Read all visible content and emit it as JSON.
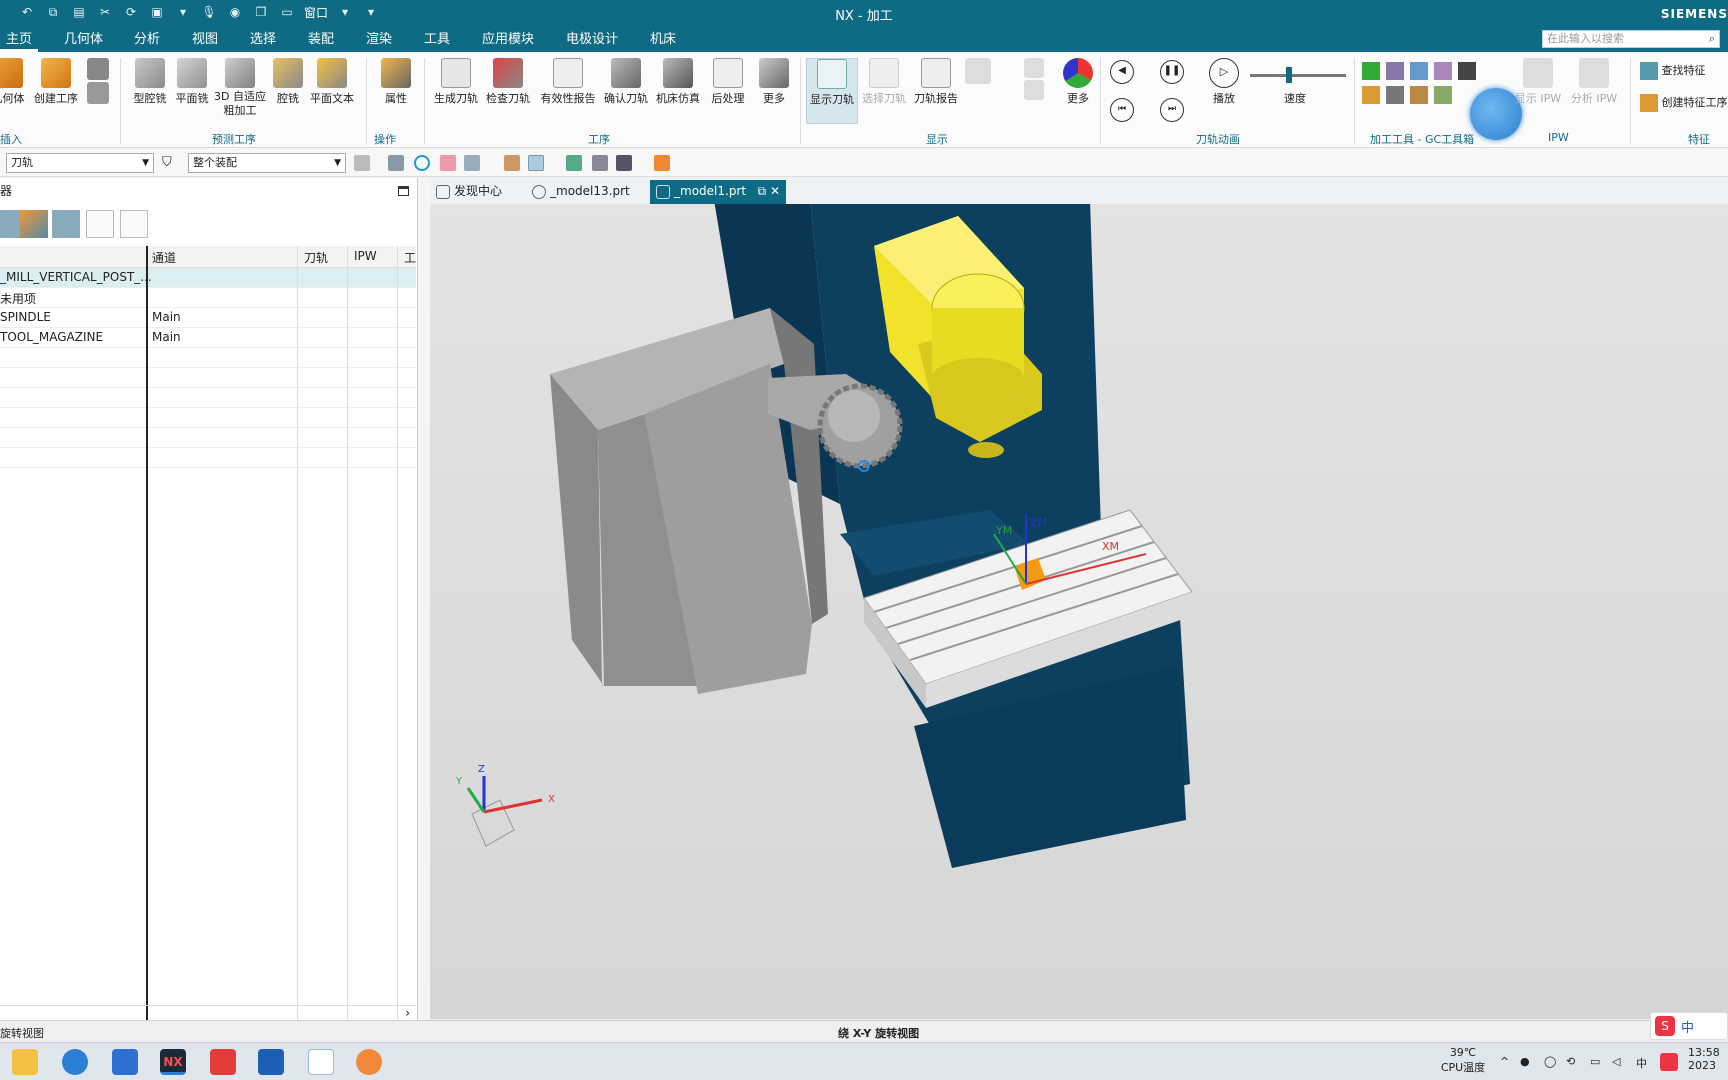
{
  "window": {
    "title": "NX - 加工",
    "brand": "SIEMENS"
  },
  "menu": {
    "tabs": [
      "主页",
      "几何体",
      "分析",
      "视图",
      "选择",
      "装配",
      "渲染",
      "工具",
      "应用模块",
      "电极设计",
      "机床"
    ],
    "active": "主页",
    "quick_access": {
      "window_label": "窗口"
    },
    "search_placeholder": "在此输入以搜索"
  },
  "ribbon": {
    "insert": {
      "label": "插入",
      "buttons": [
        "几何体",
        "创建工序"
      ]
    },
    "preset": {
      "label": "预测工序",
      "buttons": [
        "型腔铣",
        "平面铣",
        "3D 自适应粗加工",
        "腔铣",
        "平面文本"
      ]
    },
    "operate": {
      "label": "操作",
      "buttons": [
        "属性"
      ]
    },
    "operation": {
      "label": "工序",
      "buttons": [
        "生成刀轨",
        "检查刀轨",
        "有效性报告",
        "确认刀轨",
        "机床仿真",
        "后处理",
        "更多"
      ]
    },
    "display": {
      "label": "显示",
      "buttons": [
        "显示刀轨",
        "选择刀轨",
        "刀轨报告",
        "更多"
      ]
    },
    "animation": {
      "label": "刀轨动画",
      "buttons": [
        "播放",
        "速度"
      ]
    },
    "gc": {
      "label": "加工工具 - GC工具箱"
    },
    "ipw": {
      "label": "IPW",
      "buttons": [
        "显示 IPW",
        "分析 IPW"
      ]
    },
    "feature": {
      "label": "特征",
      "buttons": [
        "查找特征",
        "创建特征工序"
      ]
    }
  },
  "selection_bar": {
    "filter": "刀轨",
    "scope": "整个装配"
  },
  "navigator": {
    "title": "器",
    "columns": [
      "通道",
      "刀轨",
      "IPW",
      "工"
    ],
    "rows": [
      {
        "name": "_MILL_VERTICAL_POST_...",
        "channel": ""
      },
      {
        "name": "未用项",
        "channel": ""
      },
      {
        "name": "SPINDLE",
        "channel": "Main"
      },
      {
        "name": "TOOL_MAGAZINE",
        "channel": "Main"
      }
    ]
  },
  "doc_tabs": [
    "发现中心",
    "_model13.prt",
    "_model1.prt"
  ],
  "viewport": {
    "axis_labels": {
      "x": "X",
      "y": "Y",
      "z": "Z",
      "xm": "XM",
      "ym": "YM",
      "zm": "ZM"
    }
  },
  "status": {
    "left": "旋转视图",
    "center": "绕 X-Y 旋转视图"
  },
  "taskbar": {
    "temperature": "39℃",
    "temp_label": "CPU温度",
    "time": "13:58",
    "date": "2023",
    "ime_label": "中",
    "nx_badge": "NX"
  }
}
